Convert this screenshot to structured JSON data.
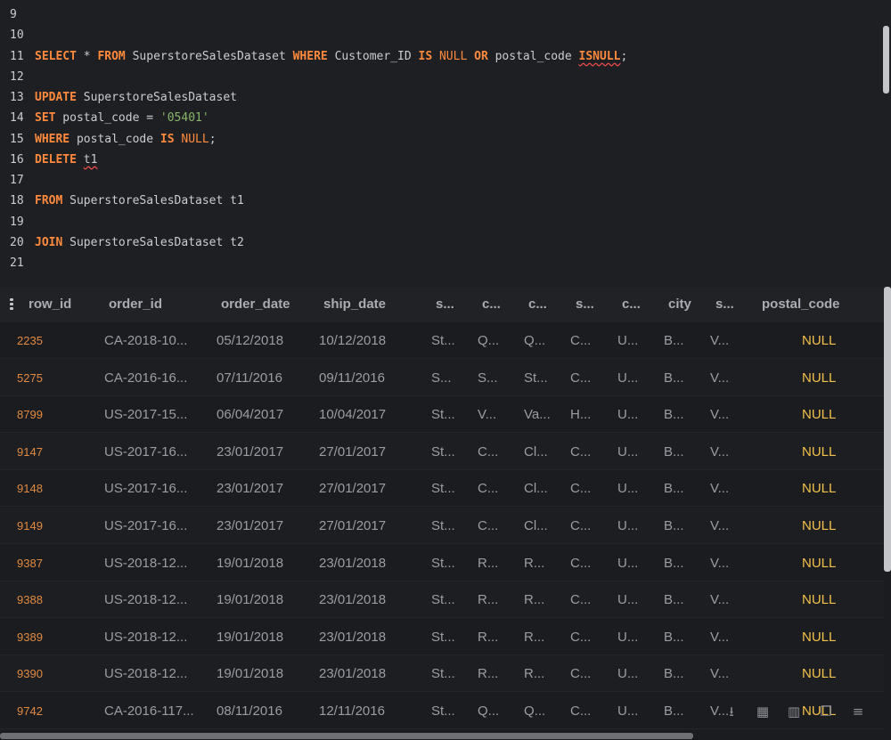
{
  "editor": {
    "lines": [
      {
        "num": "9",
        "tokens": []
      },
      {
        "num": "10",
        "tokens": []
      },
      {
        "num": "11",
        "tokens": [
          {
            "t": "SELECT",
            "c": "kw"
          },
          {
            "t": " * ",
            "c": ""
          },
          {
            "t": "FROM",
            "c": "kw"
          },
          {
            "t": " SuperstoreSalesDataset ",
            "c": ""
          },
          {
            "t": "WHERE",
            "c": "kw"
          },
          {
            "t": " Customer_ID ",
            "c": ""
          },
          {
            "t": "IS",
            "c": "kw"
          },
          {
            "t": " ",
            "c": ""
          },
          {
            "t": "NULL",
            "c": "nl"
          },
          {
            "t": " ",
            "c": ""
          },
          {
            "t": "OR",
            "c": "kw"
          },
          {
            "t": " postal_code ",
            "c": ""
          },
          {
            "t": "ISNULL",
            "c": "kw err"
          },
          {
            "t": ";",
            "c": ""
          }
        ]
      },
      {
        "num": "12",
        "tokens": []
      },
      {
        "num": "13",
        "tokens": [
          {
            "t": "UPDATE",
            "c": "kw"
          },
          {
            "t": " SuperstoreSalesDataset",
            "c": ""
          }
        ]
      },
      {
        "num": "14",
        "tokens": [
          {
            "t": "SET",
            "c": "kw"
          },
          {
            "t": " postal_code = ",
            "c": ""
          },
          {
            "t": "'05401'",
            "c": "str"
          }
        ]
      },
      {
        "num": "15",
        "tokens": [
          {
            "t": "WHERE",
            "c": "kw"
          },
          {
            "t": " postal_code ",
            "c": ""
          },
          {
            "t": "IS",
            "c": "kw"
          },
          {
            "t": " ",
            "c": ""
          },
          {
            "t": "NULL",
            "c": "nl"
          },
          {
            "t": ";",
            "c": ""
          }
        ]
      },
      {
        "num": "16",
        "tokens": [
          {
            "t": "DELETE",
            "c": "kw"
          },
          {
            "t": " ",
            "c": ""
          },
          {
            "t": "t1",
            "c": "err"
          }
        ]
      },
      {
        "num": "17",
        "tokens": []
      },
      {
        "num": "18",
        "tokens": [
          {
            "t": "FROM",
            "c": "kw"
          },
          {
            "t": " SuperstoreSalesDataset t1",
            "c": ""
          }
        ]
      },
      {
        "num": "19",
        "tokens": []
      },
      {
        "num": "20",
        "tokens": [
          {
            "t": "JOIN",
            "c": "kw"
          },
          {
            "t": " SuperstoreSalesDataset t2",
            "c": ""
          }
        ]
      },
      {
        "num": "21",
        "tokens": []
      }
    ]
  },
  "grid": {
    "headers": [
      "row_id",
      "order_id",
      "order_date",
      "ship_date",
      "s...",
      "c...",
      "c...",
      "s...",
      "c...",
      "city",
      "s...",
      "postal_code"
    ],
    "rows": [
      [
        "2235",
        "CA-2018-10...",
        "05/12/2018",
        "10/12/2018",
        "St...",
        "Q...",
        "Q...",
        "C...",
        "U...",
        "B...",
        "V...",
        "NULL"
      ],
      [
        "5275",
        "CA-2016-16...",
        "07/11/2016",
        "09/11/2016",
        "S...",
        "S...",
        "St...",
        "C...",
        "U...",
        "B...",
        "V...",
        "NULL"
      ],
      [
        "8799",
        "US-2017-15...",
        "06/04/2017",
        "10/04/2017",
        "St...",
        "V...",
        "Va...",
        "H...",
        "U...",
        "B...",
        "V...",
        "NULL"
      ],
      [
        "9147",
        "US-2017-16...",
        "23/01/2017",
        "27/01/2017",
        "St...",
        "C...",
        "Cl...",
        "C...",
        "U...",
        "B...",
        "V...",
        "NULL"
      ],
      [
        "9148",
        "US-2017-16...",
        "23/01/2017",
        "27/01/2017",
        "St...",
        "C...",
        "Cl...",
        "C...",
        "U...",
        "B...",
        "V...",
        "NULL"
      ],
      [
        "9149",
        "US-2017-16...",
        "23/01/2017",
        "27/01/2017",
        "St...",
        "C...",
        "Cl...",
        "C...",
        "U...",
        "B...",
        "V...",
        "NULL"
      ],
      [
        "9387",
        "US-2018-12...",
        "19/01/2018",
        "23/01/2018",
        "St...",
        "R...",
        "R...",
        "C...",
        "U...",
        "B...",
        "V...",
        "NULL"
      ],
      [
        "9388",
        "US-2018-12...",
        "19/01/2018",
        "23/01/2018",
        "St...",
        "R...",
        "R...",
        "C...",
        "U...",
        "B...",
        "V...",
        "NULL"
      ],
      [
        "9389",
        "US-2018-12...",
        "19/01/2018",
        "23/01/2018",
        "St...",
        "R...",
        "R...",
        "C...",
        "U...",
        "B...",
        "V...",
        "NULL"
      ],
      [
        "9390",
        "US-2018-12...",
        "19/01/2018",
        "23/01/2018",
        "St...",
        "R...",
        "R...",
        "C...",
        "U...",
        "B...",
        "V...",
        "NULL"
      ],
      [
        "9742",
        "CA-2016-117...",
        "08/11/2016",
        "12/11/2016",
        "St...",
        "Q...",
        "Q...",
        "C...",
        "U...",
        "B...",
        "V...",
        "NULL"
      ]
    ],
    "toolbar": [
      {
        "name": "download-icon",
        "glyph": "⭳"
      },
      {
        "name": "table-view-icon",
        "glyph": "▦"
      },
      {
        "name": "chart-view-icon",
        "glyph": "▥"
      },
      {
        "name": "copy-icon",
        "glyph": "❐"
      },
      {
        "name": "menu-icon",
        "glyph": "≡"
      }
    ]
  },
  "colors": {
    "keyword": "#ff8a3d",
    "string": "#87b56a",
    "row_id": "#e08a42",
    "null_value": "#f2c14b",
    "background": "#1e1f22"
  }
}
